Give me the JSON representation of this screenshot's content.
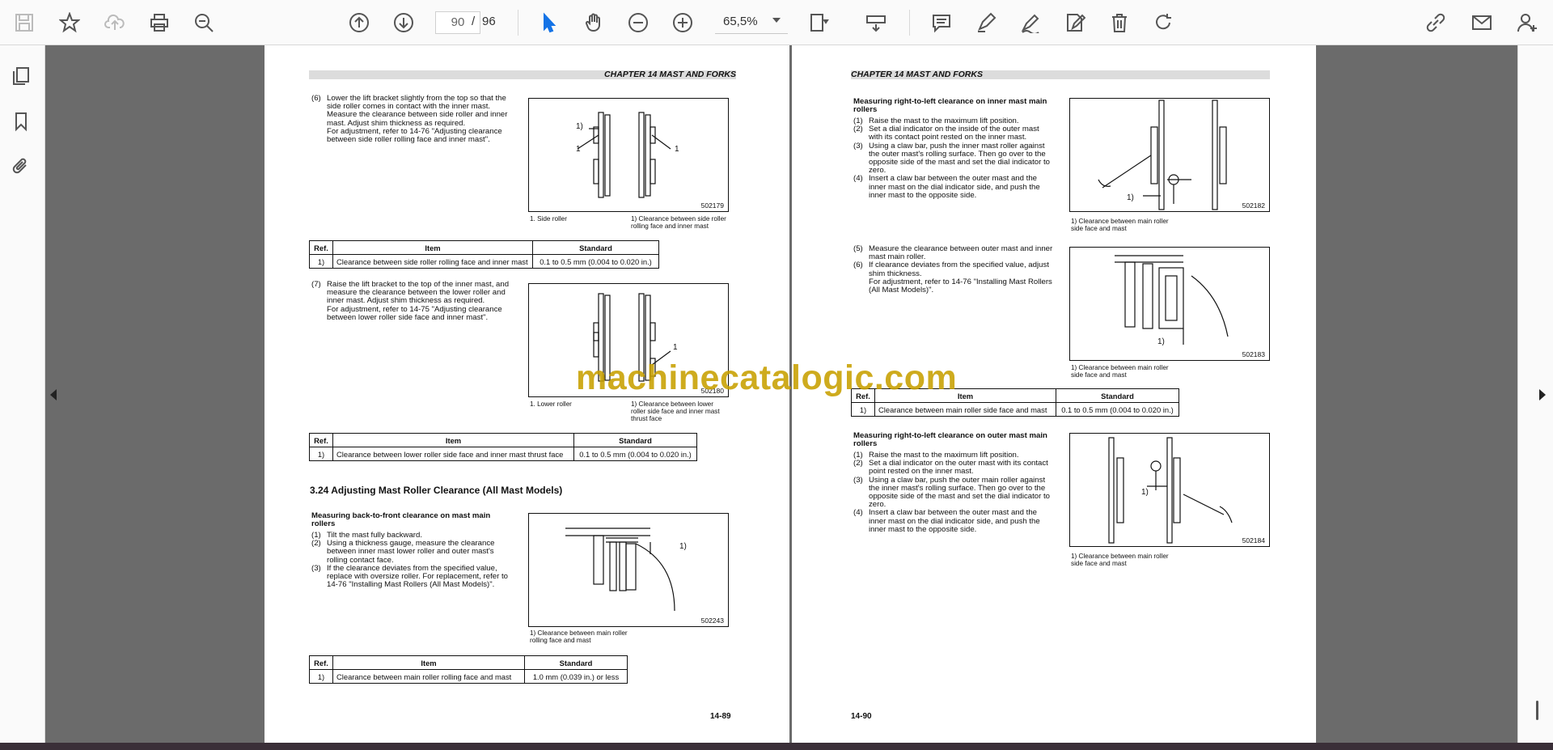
{
  "toolbar": {
    "page_current": "90",
    "page_separator": "/",
    "page_total": "96",
    "zoom": "65,5%"
  },
  "watermark": "machinecatalogic.com",
  "left_page": {
    "header": "CHAPTER 14 MAST AND FORKS",
    "step6": [
      "(6)",
      "Lower the lift bracket slightly from the top so that the side roller comes in contact with the inner mast.",
      "Measure the clearance between side roller and inner mast. Adjust shim thickness as required.",
      "For adjustment, refer to 14-76 \"Adjusting clearance between side roller rolling face and inner mast\"."
    ],
    "fig1": {
      "no": "502179",
      "cap1": "1. Side roller",
      "cap2": "1) Clearance between side roller rolling face and inner mast",
      "l1": "1)",
      "l2": "1",
      "l3": "1"
    },
    "table1": {
      "h": [
        "Ref.",
        "Item",
        "Standard"
      ],
      "r": [
        "1)",
        "Clearance between side roller rolling face and inner mast",
        "0.1 to 0.5 mm (0.004 to 0.020 in.)"
      ]
    },
    "step7": [
      "(7)",
      "Raise the lift bracket to the top of the inner mast, and measure the clearance between the lower roller and inner mast. Adjust shim thickness as required.",
      "For adjustment, refer to 14-75 \"Adjusting clearance between lower roller side face and inner mast\"."
    ],
    "fig2": {
      "no": "502180",
      "cap1": "1. Lower roller",
      "cap2": "1) Clearance between lower roller side face and inner mast thrust face",
      "l1": "1"
    },
    "table2": {
      "h": [
        "Ref.",
        "Item",
        "Standard"
      ],
      "r": [
        "1)",
        "Clearance between lower roller side face and inner mast thrust face",
        "0.1 to 0.5 mm (0.004 to 0.020 in.)"
      ]
    },
    "section": "3.24   Adjusting Mast Roller Clearance (All Mast Models)",
    "sub": "Measuring back-to-front clearance on mast main rollers",
    "s1": [
      "(1)",
      "Tilt the mast fully backward."
    ],
    "s2": [
      "(2)",
      "Using a thickness gauge, measure the clearance between inner mast lower roller and outer mast's rolling contact face."
    ],
    "s3": [
      "(3)",
      "If the clearance deviates from the specified value, replace with oversize roller. For replacement, refer to 14-76 \"Installing Mast Rollers (All Mast Models)\"."
    ],
    "fig3": {
      "no": "502243",
      "cap": "1) Clearance between main roller rolling face and mast",
      "l1": "1)"
    },
    "table3": {
      "h": [
        "Ref.",
        "Item",
        "Standard"
      ],
      "r": [
        "1)",
        "Clearance between main roller rolling face and mast",
        "1.0 mm (0.039 in.) or less"
      ]
    },
    "page_no": "14-89"
  },
  "right_page": {
    "header": "CHAPTER 14 MAST AND FORKS",
    "sub1": "Measuring right-to-left clearance on inner mast main rollers",
    "a1": [
      "(1)",
      "Raise the mast to the maximum lift position."
    ],
    "a2": [
      "(2)",
      "Set a dial indicator on the inside of the outer mast with its contact point rested on the inner mast."
    ],
    "a3": [
      "(3)",
      "Using a claw bar, push the inner mast roller against the outer mast's rolling surface. Then go over to the opposite side of the mast and set the dial indicator to zero."
    ],
    "a4": [
      "(4)",
      "Insert a claw bar between the outer mast and the inner mast on the dial indicator side, and push the inner mast to the opposite side."
    ],
    "fig4": {
      "no": "502182",
      "cap": "1) Clearance between main roller side face and mast",
      "l1": "1)"
    },
    "a5": [
      "(5)",
      "Measure the clearance between outer mast and inner mast main roller."
    ],
    "a6": [
      "(6)",
      "If clearance deviates from the specified value, adjust shim thickness.",
      "For adjustment, refer to 14-76 \"Installing Mast Rollers (All Mast Models)\"."
    ],
    "fig5": {
      "no": "502183",
      "cap": "1) Clearance between main roller side face and mast",
      "l1": "1)"
    },
    "table4": {
      "h": [
        "Ref.",
        "Item",
        "Standard"
      ],
      "r": [
        "1)",
        "Clearance between main roller side face and mast",
        "0.1 to 0.5 mm (0.004 to 0.020 in.)"
      ]
    },
    "sub2": "Measuring right-to-left clearance on outer mast main rollers",
    "b1": [
      "(1)",
      "Raise the mast to the maximum lift position."
    ],
    "b2": [
      "(2)",
      "Set a dial indicator on the outer mast with its contact point rested on the inner mast."
    ],
    "b3": [
      "(3)",
      "Using a claw bar, push the outer main roller against the inner mast's rolling surface. Then go over to the opposite side of the mast and set the dial indicator to zero."
    ],
    "b4": [
      "(4)",
      "Insert a claw bar between the outer mast and the inner mast on the dial indicator side, and push the inner mast to the opposite side."
    ],
    "fig6": {
      "no": "502184",
      "cap": "1) Clearance between main roller side face and mast",
      "l1": "1)"
    },
    "page_no": "14-90"
  }
}
